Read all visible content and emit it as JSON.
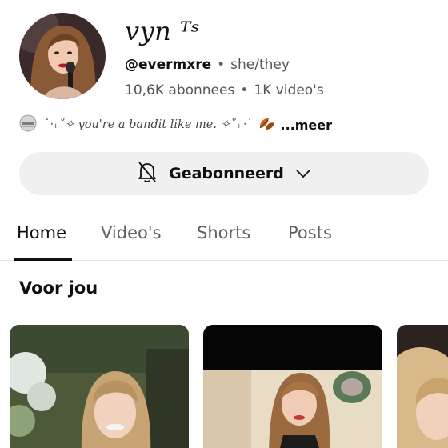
{
  "channel": {
    "name": "vyn ᵀˢ",
    "handle": "@evermxre",
    "pronouns": "she/they",
    "subscribers": "10,6K abonnees",
    "videos": "1K video's",
    "bio": "˙‧₊˚✧ you're a bandit like me. ✧˚₊‧˙",
    "more_label": "...meer"
  },
  "subscribe_button": {
    "label": "Geabonneerd",
    "bell_icon": "bell-off-icon",
    "dropdown_icon": "chevron-down-icon"
  },
  "tabs": [
    {
      "label": "Home",
      "active": true
    },
    {
      "label": "Video's",
      "active": false
    },
    {
      "label": "Shorts",
      "active": false
    },
    {
      "label": "Posts",
      "active": false
    }
  ],
  "section": {
    "title": "Voor jou"
  },
  "colors": {
    "text": "#0f0f0f",
    "secondary": "#606060",
    "button_bg": "#f0f0f0"
  }
}
